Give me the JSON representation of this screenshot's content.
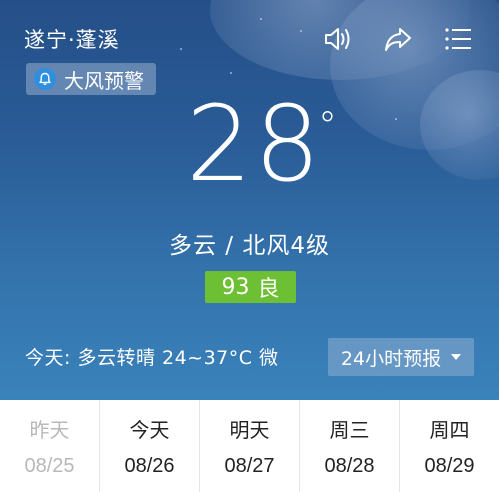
{
  "header": {
    "location": "遂宁·蓬溪",
    "icons": [
      "speaker-icon",
      "share-icon",
      "menu-icon"
    ]
  },
  "alert": {
    "icon": "bell-icon",
    "label": "大风预警"
  },
  "current": {
    "temperature": "28",
    "degree_symbol": "°",
    "condition": "多云 / 北风4级",
    "aqi_value": "93",
    "aqi_level": "良",
    "aqi_color": "#6dbf34"
  },
  "today_summary": {
    "text": "今天:  多云转晴   24~37°C  微"
  },
  "forecast_button": {
    "label": "24小时预报"
  },
  "days": [
    {
      "name": "昨天",
      "date": "08/25"
    },
    {
      "name": "今天",
      "date": "08/26"
    },
    {
      "name": "明天",
      "date": "08/27"
    },
    {
      "name": "周三",
      "date": "08/28"
    },
    {
      "name": "周四",
      "date": "08/29"
    }
  ]
}
